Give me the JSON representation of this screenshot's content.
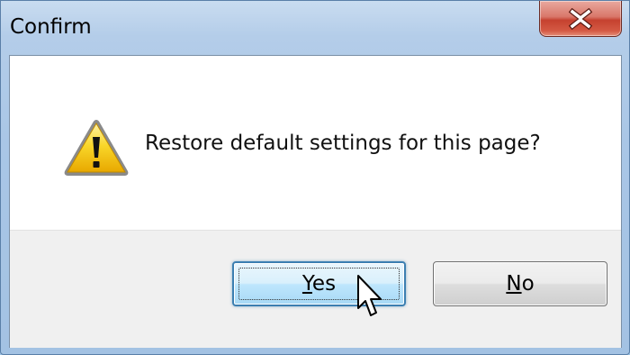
{
  "window": {
    "title": "Confirm",
    "close_icon": "close-icon"
  },
  "dialog": {
    "icon": "warning-icon",
    "message": "Restore default settings for this page?",
    "buttons": {
      "yes": "Yes",
      "no": "No"
    }
  },
  "colors": {
    "close_button": "#c5412f",
    "focused_button_border": "#3c7fb1",
    "warning_fill": "#f5c400"
  }
}
